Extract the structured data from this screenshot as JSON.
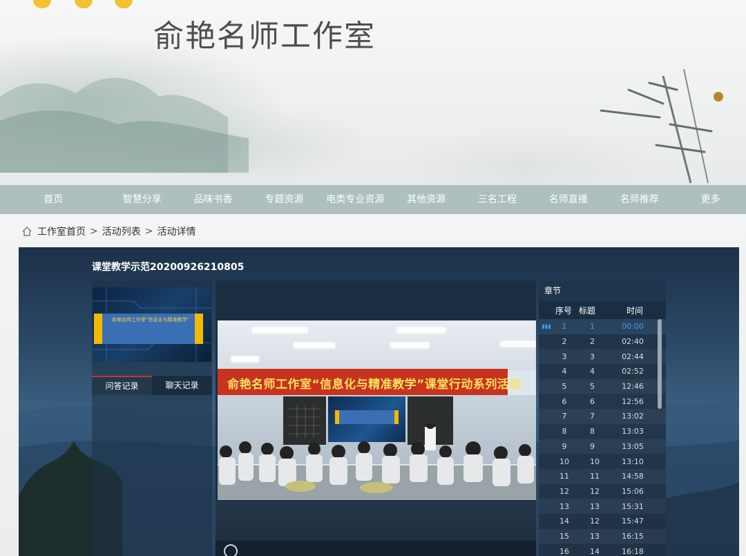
{
  "header": {
    "site_title": "俞艳名师工作室"
  },
  "nav": {
    "items": [
      "首页",
      "智慧分享",
      "品味书香",
      "专题资源",
      "电类专业资源",
      "其他资源",
      "三名工程",
      "名师直播",
      "名师推荐",
      "更多"
    ]
  },
  "breadcrumb": {
    "items": [
      "工作室首页",
      "活动列表",
      "活动详情"
    ],
    "separator": ">"
  },
  "video": {
    "title": "课堂教学示范20200926210805",
    "banner_text": "俞艳名师工作室“信息化与精准教学”课堂行动系列活动",
    "thumb_text": "俞艳名师工作室“信息化与精准教学”"
  },
  "tabs": {
    "qa": "问答记录",
    "chat": "聊天记录"
  },
  "chapters": {
    "heading": "章节",
    "columns": {
      "index": "序号",
      "title": "标题",
      "time": "时间"
    },
    "rows": [
      {
        "index": "1",
        "title": "1",
        "time": "00:00",
        "active": true
      },
      {
        "index": "2",
        "title": "2",
        "time": "02:40"
      },
      {
        "index": "3",
        "title": "3",
        "time": "02:44"
      },
      {
        "index": "4",
        "title": "4",
        "time": "02:52"
      },
      {
        "index": "5",
        "title": "5",
        "time": "12:46"
      },
      {
        "index": "6",
        "title": "6",
        "time": "12:56"
      },
      {
        "index": "7",
        "title": "7",
        "time": "13:02"
      },
      {
        "index": "8",
        "title": "8",
        "time": "13:03"
      },
      {
        "index": "9",
        "title": "9",
        "time": "13:05"
      },
      {
        "index": "10",
        "title": "10",
        "time": "13:10"
      },
      {
        "index": "11",
        "title": "11",
        "time": "14:58"
      },
      {
        "index": "12",
        "title": "12",
        "time": "15:06"
      },
      {
        "index": "13",
        "title": "13",
        "time": "15:31"
      },
      {
        "index": "14",
        "title": "12",
        "time": "15:47"
      },
      {
        "index": "15",
        "title": "13",
        "time": "16:15"
      },
      {
        "index": "16",
        "title": "14",
        "time": "16:18"
      }
    ]
  },
  "colors": {
    "nav_bg": "#adbfbe",
    "active_chapter": "#3a9cff",
    "tab_accent": "#c0392b"
  }
}
